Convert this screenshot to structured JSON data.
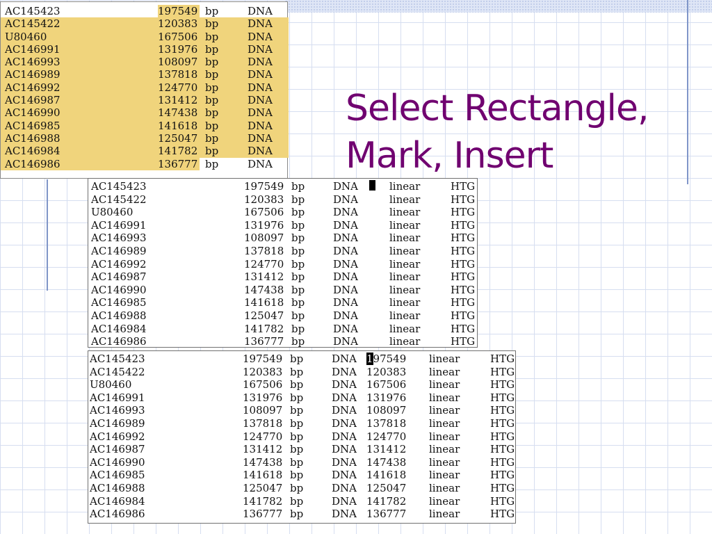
{
  "slide": {
    "title_line1": "Select Rectangle,",
    "title_line2": "Mark, Insert"
  },
  "colors": {
    "title": "#700070",
    "selection_highlight": "#f0d47c",
    "grid_line": "#d6def0"
  },
  "panel_top": {
    "rows": [
      {
        "id": "AC145423",
        "length": "197549",
        "unit": "bp",
        "type": "DNA",
        "highlight": "partial"
      },
      {
        "id": "AC145422",
        "length": "120383",
        "unit": "bp",
        "type": "DNA",
        "highlight": "full"
      },
      {
        "id": "U80460",
        "length": "167506",
        "unit": "bp",
        "type": "DNA",
        "highlight": "full"
      },
      {
        "id": "AC146991",
        "length": "131976",
        "unit": "bp",
        "type": "DNA",
        "highlight": "full"
      },
      {
        "id": "AC146993",
        "length": "108097",
        "unit": "bp",
        "type": "DNA",
        "highlight": "full"
      },
      {
        "id": "AC146989",
        "length": "137818",
        "unit": "bp",
        "type": "DNA",
        "highlight": "full"
      },
      {
        "id": "AC146992",
        "length": "124770",
        "unit": "bp",
        "type": "DNA",
        "highlight": "full"
      },
      {
        "id": "AC146987",
        "length": "131412",
        "unit": "bp",
        "type": "DNA",
        "highlight": "full"
      },
      {
        "id": "AC146990",
        "length": "147438",
        "unit": "bp",
        "type": "DNA",
        "highlight": "full"
      },
      {
        "id": "AC146985",
        "length": "141618",
        "unit": "bp",
        "type": "DNA",
        "highlight": "full"
      },
      {
        "id": "AC146988",
        "length": "125047",
        "unit": "bp",
        "type": "DNA",
        "highlight": "full"
      },
      {
        "id": "AC146984",
        "length": "141782",
        "unit": "bp",
        "type": "DNA",
        "highlight": "full"
      },
      {
        "id": "AC146986",
        "length": "136777",
        "unit": "bp",
        "type": "DNA",
        "highlight": "end"
      }
    ]
  },
  "panel_middle": {
    "rows": [
      {
        "id": "AC145423",
        "length": "197549",
        "unit": "bp",
        "type": "DNA",
        "topology": "linear",
        "division": "HTG"
      },
      {
        "id": "AC145422",
        "length": "120383",
        "unit": "bp",
        "type": "DNA",
        "topology": "linear",
        "division": "HTG"
      },
      {
        "id": "U80460",
        "length": "167506",
        "unit": "bp",
        "type": "DNA",
        "topology": "linear",
        "division": "HTG"
      },
      {
        "id": "AC146991",
        "length": "131976",
        "unit": "bp",
        "type": "DNA",
        "topology": "linear",
        "division": "HTG"
      },
      {
        "id": "AC146993",
        "length": "108097",
        "unit": "bp",
        "type": "DNA",
        "topology": "linear",
        "division": "HTG"
      },
      {
        "id": "AC146989",
        "length": "137818",
        "unit": "bp",
        "type": "DNA",
        "topology": "linear",
        "division": "HTG"
      },
      {
        "id": "AC146992",
        "length": "124770",
        "unit": "bp",
        "type": "DNA",
        "topology": "linear",
        "division": "HTG"
      },
      {
        "id": "AC146987",
        "length": "131412",
        "unit": "bp",
        "type": "DNA",
        "topology": "linear",
        "division": "HTG"
      },
      {
        "id": "AC146990",
        "length": "147438",
        "unit": "bp",
        "type": "DNA",
        "topology": "linear",
        "division": "HTG"
      },
      {
        "id": "AC146985",
        "length": "141618",
        "unit": "bp",
        "type": "DNA",
        "topology": "linear",
        "division": "HTG"
      },
      {
        "id": "AC146988",
        "length": "125047",
        "unit": "bp",
        "type": "DNA",
        "topology": "linear",
        "division": "HTG"
      },
      {
        "id": "AC146984",
        "length": "141782",
        "unit": "bp",
        "type": "DNA",
        "topology": "linear",
        "division": "HTG"
      },
      {
        "id": "AC146986",
        "length": "136777",
        "unit": "bp",
        "type": "DNA",
        "topology": "linear",
        "division": "HTG"
      }
    ]
  },
  "panel_bottom": {
    "rows": [
      {
        "id": "AC145423",
        "length": "197549",
        "unit": "bp",
        "type": "DNA",
        "inserted": "197549",
        "topology": "linear",
        "division": "HTG"
      },
      {
        "id": "AC145422",
        "length": "120383",
        "unit": "bp",
        "type": "DNA",
        "inserted": "120383",
        "topology": "linear",
        "division": "HTG"
      },
      {
        "id": "U80460",
        "length": "167506",
        "unit": "bp",
        "type": "DNA",
        "inserted": "167506",
        "topology": "linear",
        "division": "HTG"
      },
      {
        "id": "AC146991",
        "length": "131976",
        "unit": "bp",
        "type": "DNA",
        "inserted": "131976",
        "topology": "linear",
        "division": "HTG"
      },
      {
        "id": "AC146993",
        "length": "108097",
        "unit": "bp",
        "type": "DNA",
        "inserted": "108097",
        "topology": "linear",
        "division": "HTG"
      },
      {
        "id": "AC146989",
        "length": "137818",
        "unit": "bp",
        "type": "DNA",
        "inserted": "137818",
        "topology": "linear",
        "division": "HTG"
      },
      {
        "id": "AC146992",
        "length": "124770",
        "unit": "bp",
        "type": "DNA",
        "inserted": "124770",
        "topology": "linear",
        "division": "HTG"
      },
      {
        "id": "AC146987",
        "length": "131412",
        "unit": "bp",
        "type": "DNA",
        "inserted": "131412",
        "topology": "linear",
        "division": "HTG"
      },
      {
        "id": "AC146990",
        "length": "147438",
        "unit": "bp",
        "type": "DNA",
        "inserted": "147438",
        "topology": "linear",
        "division": "HTG"
      },
      {
        "id": "AC146985",
        "length": "141618",
        "unit": "bp",
        "type": "DNA",
        "inserted": "141618",
        "topology": "linear",
        "division": "HTG"
      },
      {
        "id": "AC146988",
        "length": "125047",
        "unit": "bp",
        "type": "DNA",
        "inserted": "125047",
        "topology": "linear",
        "division": "HTG"
      },
      {
        "id": "AC146984",
        "length": "141782",
        "unit": "bp",
        "type": "DNA",
        "inserted": "141782",
        "topology": "linear",
        "division": "HTG"
      },
      {
        "id": "AC146986",
        "length": "136777",
        "unit": "bp",
        "type": "DNA",
        "inserted": "136777",
        "topology": "linear",
        "division": "HTG"
      }
    ]
  }
}
